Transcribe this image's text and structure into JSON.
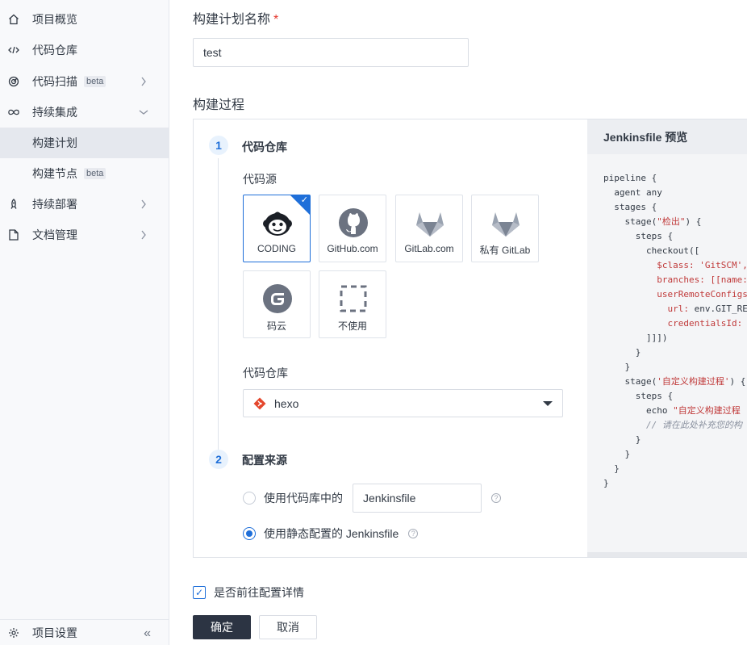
{
  "sidebar": {
    "items": [
      {
        "label": "项目概览",
        "icon": "home-icon"
      },
      {
        "label": "代码仓库",
        "icon": "code-icon"
      },
      {
        "label": "代码扫描",
        "badge": "beta",
        "icon": "scan-icon"
      },
      {
        "label": "持续集成",
        "icon": "infinity-icon"
      },
      {
        "label": "持续部署",
        "icon": "rocket-icon"
      },
      {
        "label": "文档管理",
        "icon": "document-icon"
      }
    ],
    "sub_items": [
      {
        "label": "构建计划",
        "active": true
      },
      {
        "label": "构建节点",
        "badge": "beta"
      }
    ],
    "footer": {
      "label": "项目设置",
      "collapse": "«"
    }
  },
  "form": {
    "name_label": "构建计划名称",
    "required_mark": "*",
    "name_value": "test",
    "process_label": "构建过程",
    "step1": {
      "number": "1",
      "title": "代码仓库",
      "source_label": "代码源",
      "sources": [
        {
          "name": "CODING",
          "selected": true
        },
        {
          "name": "GitHub.com"
        },
        {
          "name": "GitLab.com"
        },
        {
          "name": "私有 GitLab"
        },
        {
          "name": "码云"
        },
        {
          "name": "不使用"
        }
      ],
      "repo_label": "代码仓库",
      "repo_value": "hexo"
    },
    "step2": {
      "number": "2",
      "title": "配置来源",
      "option1_label": "使用代码库中的",
      "option1_input": "Jenkinsfile",
      "option2_label": "使用静态配置的 Jenkinsfile",
      "help": "?"
    },
    "goto_detail_label": "是否前往配置详情",
    "confirm": "确定",
    "cancel": "取消"
  },
  "preview": {
    "title": "Jenkinsfile 预览"
  },
  "colors": {
    "primary": "#1f6fd9",
    "dark_button": "#2c3443",
    "required": "#e4382e"
  }
}
